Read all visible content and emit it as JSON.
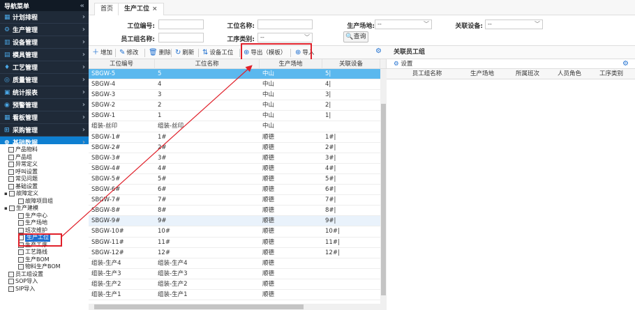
{
  "sidebar": {
    "title": "导航菜单",
    "collapse_glyph": "«",
    "items": [
      {
        "label": "计划排程",
        "icon": "calendar-icon"
      },
      {
        "label": "生产管理",
        "icon": "gear-icon"
      },
      {
        "label": "设备管理",
        "icon": "equipment-icon"
      },
      {
        "label": "模具管理",
        "icon": "mold-icon"
      },
      {
        "label": "工艺管理",
        "icon": "process-icon"
      },
      {
        "label": "质量管理",
        "icon": "quality-icon"
      },
      {
        "label": "统计报表",
        "icon": "report-icon"
      },
      {
        "label": "预警管理",
        "icon": "alert-icon"
      },
      {
        "label": "看板管理",
        "icon": "board-icon"
      },
      {
        "label": "采购管理",
        "icon": "cart-icon"
      },
      {
        "label": "基础数据",
        "icon": "data-icon"
      }
    ],
    "tree": [
      {
        "label": "产品物料",
        "level": 1
      },
      {
        "label": "产品组",
        "level": 1
      },
      {
        "label": "异常定义",
        "level": 1
      },
      {
        "label": "呼叫设置",
        "level": 1
      },
      {
        "label": "常见问题",
        "level": 1
      },
      {
        "label": "基础设置",
        "level": 1
      },
      {
        "label": "故障定义",
        "level": 0,
        "toggle": "−"
      },
      {
        "label": "故障项目组",
        "level": 2
      },
      {
        "label": "生产建模",
        "level": 0,
        "toggle": "−"
      },
      {
        "label": "生产中心",
        "level": 2
      },
      {
        "label": "生产场地",
        "level": 2
      },
      {
        "label": "班次维护",
        "level": 2
      },
      {
        "label": "生产工位",
        "level": 2,
        "selected": true
      },
      {
        "label": "生产工序",
        "level": 2
      },
      {
        "label": "工艺路线",
        "level": 2
      },
      {
        "label": "生产BOM",
        "level": 2
      },
      {
        "label": "物料生产BOM",
        "level": 2
      },
      {
        "label": "员工组设置",
        "level": 1
      },
      {
        "label": "SOP导入",
        "level": 1
      },
      {
        "label": "SIP导入",
        "level": 1
      }
    ]
  },
  "tabs": [
    {
      "label": "首页"
    },
    {
      "label": "生产工位",
      "close": "×"
    }
  ],
  "form": {
    "station_code_label": "工位编号:",
    "station_name_label": "工位名称:",
    "site_label": "生产场地:",
    "site_value": "--",
    "device_label": "关联设备:",
    "device_value": "--",
    "group_label": "员工组名称:",
    "process_label": "工序类别:",
    "process_value": "--",
    "query_label": "查询"
  },
  "toolbar": {
    "add": "增加",
    "edit": "修改",
    "delete": "删除",
    "refresh": "刷新",
    "device_station": "设备工位",
    "export": "导出（模板）",
    "import": "导入"
  },
  "grid": {
    "columns": [
      "工位编号",
      "工位名称",
      "生产场地",
      "关联设备"
    ],
    "rows": [
      [
        "SBGW-5",
        "5",
        "中山",
        "5|"
      ],
      [
        "SBGW-4",
        "4",
        "中山",
        "4|"
      ],
      [
        "SBGW-3",
        "3",
        "中山",
        "3|"
      ],
      [
        "SBGW-2",
        "2",
        "中山",
        "2|"
      ],
      [
        "SBGW-1",
        "1",
        "中山",
        "1|"
      ],
      [
        "组装-丝印",
        "组装-丝印",
        "中山",
        ""
      ],
      [
        "SBGW-1#",
        "1#",
        "顺德",
        "1#|"
      ],
      [
        "SBGW-2#",
        "2#",
        "顺德",
        "2#|"
      ],
      [
        "SBGW-3#",
        "3#",
        "顺德",
        "3#|"
      ],
      [
        "SBGW-4#",
        "4#",
        "顺德",
        "4#|"
      ],
      [
        "SBGW-5#",
        "5#",
        "顺德",
        "5#|"
      ],
      [
        "SBGW-6#",
        "6#",
        "顺德",
        "6#|"
      ],
      [
        "SBGW-7#",
        "7#",
        "顺德",
        "7#|"
      ],
      [
        "SBGW-8#",
        "8#",
        "顺德",
        "8#|"
      ],
      [
        "SBGW-9#",
        "9#",
        "顺德",
        "9#|"
      ],
      [
        "SBGW-10#",
        "10#",
        "顺德",
        "10#|"
      ],
      [
        "SBGW-11#",
        "11#",
        "顺德",
        "11#|"
      ],
      [
        "SBGW-12#",
        "12#",
        "顺德",
        "12#|"
      ],
      [
        "组装-生产4",
        "组装-生产4",
        "顺德",
        ""
      ],
      [
        "组装-生产3",
        "组装-生产3",
        "顺德",
        ""
      ],
      [
        "组装-生产2",
        "组装-生产2",
        "顺德",
        ""
      ],
      [
        "组装-生产1",
        "组装-生产1",
        "顺德",
        ""
      ]
    ]
  },
  "right_panel": {
    "title": "关联员工组",
    "settings_label": "设置",
    "columns": [
      "员工组名称",
      "生产场地",
      "所属班次",
      "人员角色",
      "工序类别"
    ]
  },
  "colors": {
    "sidebar_bg": "#1f2a38",
    "active_menu": "#0e7fd1",
    "selected_row": "#5bb8ee",
    "highlight_red": "#e0202a"
  }
}
